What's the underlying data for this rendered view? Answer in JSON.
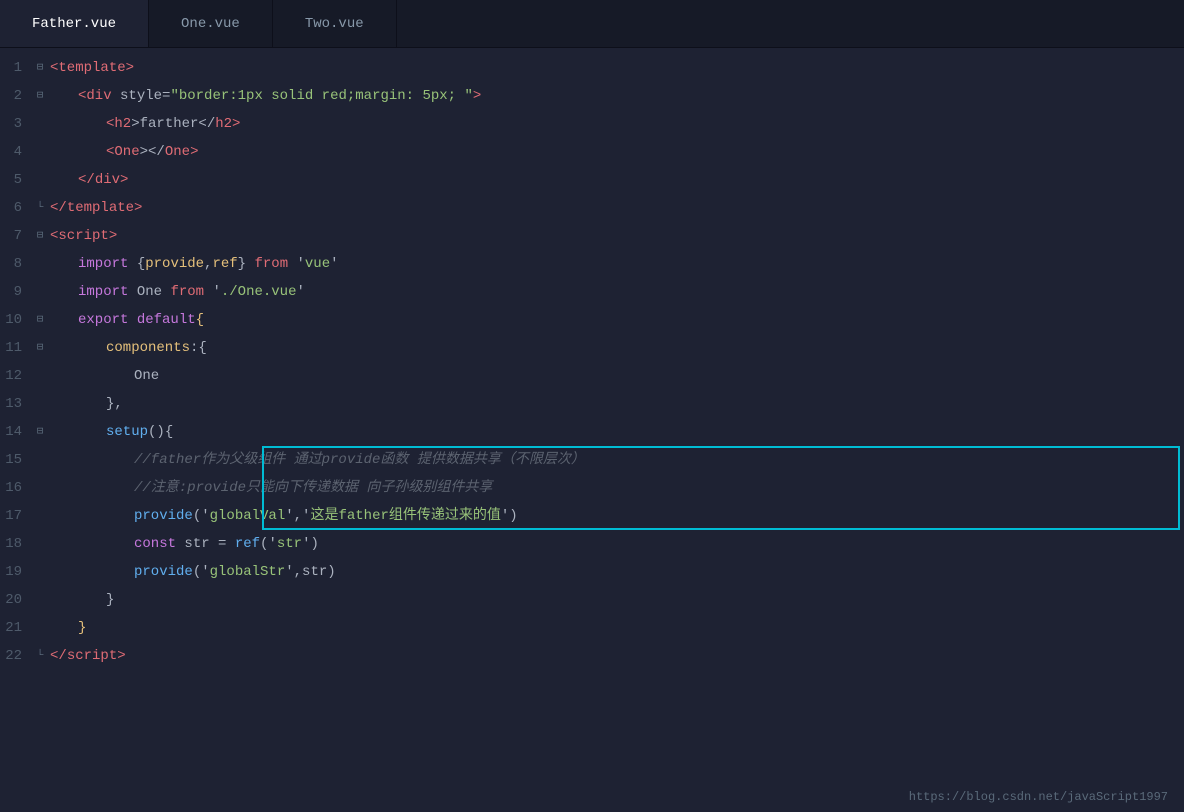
{
  "tabs": [
    {
      "label": "Father.vue",
      "active": true
    },
    {
      "label": "One.vue",
      "active": false
    },
    {
      "label": "Two.vue",
      "active": false
    }
  ],
  "lines": [
    {
      "num": 1,
      "fold": "⊟",
      "indent": 0,
      "tokens": [
        {
          "t": "<",
          "c": "c-tag"
        },
        {
          "t": "template",
          "c": "c-tag"
        },
        {
          "t": ">",
          "c": "c-tag"
        }
      ]
    },
    {
      "num": 2,
      "fold": "⊟",
      "indent": 1,
      "tokens": [
        {
          "t": "<",
          "c": "c-tag"
        },
        {
          "t": "div",
          "c": "c-tag"
        },
        {
          "t": " style=",
          "c": "c-white"
        },
        {
          "t": "\"border:1px solid red;margin: 5px; \"",
          "c": "c-green"
        },
        {
          "t": ">",
          "c": "c-tag"
        }
      ]
    },
    {
      "num": 3,
      "fold": " ",
      "indent": 2,
      "tokens": [
        {
          "t": "<",
          "c": "c-tag"
        },
        {
          "t": "h2",
          "c": "c-tag"
        },
        {
          "t": ">farther</",
          "c": "c-white"
        },
        {
          "t": "h2",
          "c": "c-tag"
        },
        {
          "t": ">",
          "c": "c-tag"
        }
      ]
    },
    {
      "num": 4,
      "fold": " ",
      "indent": 2,
      "tokens": [
        {
          "t": "<",
          "c": "c-tag"
        },
        {
          "t": "One",
          "c": "c-tag"
        },
        {
          "t": "></",
          "c": "c-white"
        },
        {
          "t": "One",
          "c": "c-tag"
        },
        {
          "t": ">",
          "c": "c-tag"
        }
      ]
    },
    {
      "num": 5,
      "fold": " ",
      "indent": 1,
      "tokens": [
        {
          "t": "</",
          "c": "c-tag"
        },
        {
          "t": "div",
          "c": "c-tag"
        },
        {
          "t": ">",
          "c": "c-tag"
        }
      ]
    },
    {
      "num": 6,
      "fold": "─",
      "indent": 0,
      "tokens": [
        {
          "t": "</",
          "c": "c-tag"
        },
        {
          "t": "template",
          "c": "c-tag"
        },
        {
          "t": ">",
          "c": "c-tag"
        }
      ]
    },
    {
      "num": 7,
      "fold": "⊟",
      "indent": 0,
      "tokens": [
        {
          "t": "<",
          "c": "c-tag"
        },
        {
          "t": "script",
          "c": "c-tag"
        },
        {
          "t": ">",
          "c": "c-tag"
        }
      ]
    },
    {
      "num": 8,
      "fold": " ",
      "indent": 1,
      "tokens": [
        {
          "t": "import",
          "c": "c-import"
        },
        {
          "t": " {",
          "c": "c-white"
        },
        {
          "t": "provide",
          "c": "c-yellow"
        },
        {
          "t": ",",
          "c": "c-white"
        },
        {
          "t": "ref",
          "c": "c-yellow"
        },
        {
          "t": "} ",
          "c": "c-white"
        },
        {
          "t": "from",
          "c": "c-from"
        },
        {
          "t": " '",
          "c": "c-white"
        },
        {
          "t": "vue",
          "c": "c-green"
        },
        {
          "t": "'",
          "c": "c-white"
        }
      ]
    },
    {
      "num": 9,
      "fold": " ",
      "indent": 1,
      "tokens": [
        {
          "t": "import",
          "c": "c-import"
        },
        {
          "t": " One ",
          "c": "c-white"
        },
        {
          "t": "from",
          "c": "c-from"
        },
        {
          "t": " '",
          "c": "c-white"
        },
        {
          "t": "./One.vue",
          "c": "c-green"
        },
        {
          "t": "'",
          "c": "c-white"
        }
      ]
    },
    {
      "num": 10,
      "fold": "⊟",
      "indent": 1,
      "tokens": [
        {
          "t": "export",
          "c": "c-keyword"
        },
        {
          "t": " ",
          "c": "c-white"
        },
        {
          "t": "default",
          "c": "c-keyword"
        },
        {
          "t": "{",
          "c": "c-bracket"
        }
      ]
    },
    {
      "num": 11,
      "fold": "⊟",
      "indent": 2,
      "tokens": [
        {
          "t": "components",
          "c": "c-yellow"
        },
        {
          "t": ":{",
          "c": "c-white"
        }
      ]
    },
    {
      "num": 12,
      "fold": " ",
      "indent": 3,
      "tokens": [
        {
          "t": "One",
          "c": "c-white"
        }
      ]
    },
    {
      "num": 13,
      "fold": " ",
      "indent": 2,
      "tokens": [
        {
          "t": "},",
          "c": "c-white"
        }
      ]
    },
    {
      "num": 14,
      "fold": "⊟",
      "indent": 2,
      "tokens": [
        {
          "t": "setup",
          "c": "c-fn"
        },
        {
          "t": "(){",
          "c": "c-white"
        }
      ]
    },
    {
      "num": 15,
      "fold": " ",
      "indent": 3,
      "highlight": true,
      "tokens": [
        {
          "t": "//father作为父级组件 通过provide函数 提供数据共享（不限层次）",
          "c": "c-comment"
        }
      ]
    },
    {
      "num": 16,
      "fold": " ",
      "indent": 3,
      "highlight": true,
      "tokens": [
        {
          "t": "//注意:provide只能向下传递数据 向子孙级别组件共享",
          "c": "c-comment"
        }
      ]
    },
    {
      "num": 17,
      "fold": " ",
      "indent": 3,
      "highlight": true,
      "tokens": [
        {
          "t": "provide",
          "c": "c-provide"
        },
        {
          "t": "('",
          "c": "c-white"
        },
        {
          "t": "globalVal",
          "c": "c-green"
        },
        {
          "t": "','",
          "c": "c-white"
        },
        {
          "t": "这是father组件传递过来的值",
          "c": "c-green"
        },
        {
          "t": "')",
          "c": "c-white"
        }
      ]
    },
    {
      "num": 18,
      "fold": " ",
      "indent": 3,
      "tokens": [
        {
          "t": "const",
          "c": "c-keyword"
        },
        {
          "t": " str = ",
          "c": "c-white"
        },
        {
          "t": "ref",
          "c": "c-fn"
        },
        {
          "t": "('",
          "c": "c-white"
        },
        {
          "t": "str",
          "c": "c-green"
        },
        {
          "t": "')",
          "c": "c-white"
        }
      ]
    },
    {
      "num": 19,
      "fold": " ",
      "indent": 3,
      "tokens": [
        {
          "t": "provide",
          "c": "c-provide"
        },
        {
          "t": "('",
          "c": "c-white"
        },
        {
          "t": "globalStr",
          "c": "c-green"
        },
        {
          "t": "',str)",
          "c": "c-white"
        }
      ]
    },
    {
      "num": 20,
      "fold": " ",
      "indent": 2,
      "tokens": [
        {
          "t": "}",
          "c": "c-white"
        }
      ]
    },
    {
      "num": 21,
      "fold": " ",
      "indent": 1,
      "tokens": [
        {
          "t": "}",
          "c": "c-bracket"
        }
      ]
    },
    {
      "num": 22,
      "fold": "─",
      "indent": 0,
      "tokens": [
        {
          "t": "</",
          "c": "c-tag"
        },
        {
          "t": "script",
          "c": "c-tag"
        },
        {
          "t": ">",
          "c": "c-tag"
        }
      ]
    }
  ],
  "watermark": "https://blog.csdn.net/javaScript1997"
}
